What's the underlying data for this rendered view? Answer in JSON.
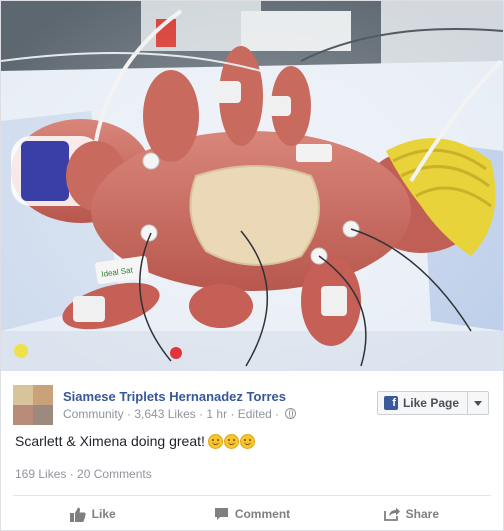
{
  "post": {
    "page_name": "Siamese Triplets Hernanadez Torres",
    "category": "Community",
    "likes": "3,643 Likes",
    "time": "1 hr",
    "edited": "Edited",
    "message": "Scarlett & Ximena doing great!",
    "emoji_count": 3,
    "reactions": "169 Likes",
    "comments": "20 Comments"
  },
  "like_page_button": {
    "label": "Like Page"
  },
  "actions": {
    "like": "Like",
    "comment": "Comment",
    "share": "Share"
  },
  "photo": {
    "band_label": "Ideal Sat"
  },
  "colors": {
    "link_blue": "#365899",
    "facebook_blue": "#3b5998",
    "muted_text": "#90949c",
    "emoji_yellow": "#f7c62f",
    "knit_hat_yellow": "#e8d33a",
    "headband_purple": "#3a3fa8"
  },
  "icons": [
    "globe-icon",
    "facebook-f-icon",
    "caret-down-icon",
    "thumbs-up-icon",
    "comment-icon",
    "share-icon",
    "smiley-icon"
  ]
}
